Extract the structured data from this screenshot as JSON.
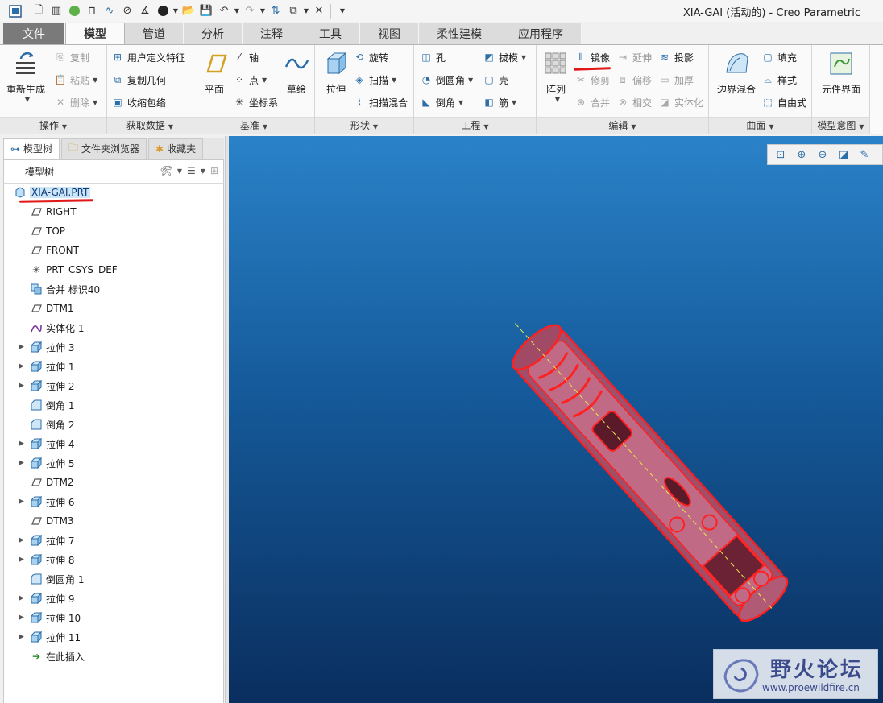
{
  "window": {
    "title": "XIA-GAI (活动的) - Creo Parametric"
  },
  "ribbon_tabs": [
    {
      "label": "文件"
    },
    {
      "label": "模型"
    },
    {
      "label": "管道"
    },
    {
      "label": "分析"
    },
    {
      "label": "注释"
    },
    {
      "label": "工具"
    },
    {
      "label": "视图"
    },
    {
      "label": "柔性建模"
    },
    {
      "label": "应用程序"
    }
  ],
  "groups": {
    "operations": {
      "label": "操作",
      "regenerate": "重新生成",
      "copy": "复制",
      "paste": "粘贴",
      "delete": "删除"
    },
    "get_data": {
      "label": "获取数据",
      "udf": "用户定义特征",
      "copy_geom": "复制几何",
      "shrinkwrap": "收缩包络"
    },
    "datum": {
      "label": "基准",
      "plane": "平面",
      "axis": "轴",
      "point": "点",
      "csys": "坐标系",
      "sketch": "草绘"
    },
    "shapes": {
      "label": "形状",
      "extrude": "拉伸",
      "revolve": "旋转",
      "sweep": "扫描",
      "swept_blend": "扫描混合"
    },
    "engineering": {
      "label": "工程",
      "hole": "孔",
      "round": "倒圆角",
      "chamfer": "倒角",
      "draft": "拔模",
      "shell": "壳",
      "rib": "筋"
    },
    "editing": {
      "label": "编辑",
      "pattern": "阵列",
      "mirror": "镜像",
      "extend": "延伸",
      "project": "投影",
      "trim": "修剪",
      "offset": "偏移",
      "thicken": "加厚",
      "merge": "合并",
      "intersect": "相交",
      "solidify": "实体化"
    },
    "surfaces": {
      "label": "曲面",
      "boundary_blend": "边界混合",
      "fill": "填充",
      "style": "样式",
      "freestyle": "自由式"
    },
    "model_intent": {
      "label": "模型意图",
      "component_interface": "元件界面"
    }
  },
  "navigator": {
    "tabs": [
      {
        "label": "模型树"
      },
      {
        "label": "文件夹浏览器"
      },
      {
        "label": "收藏夹"
      }
    ],
    "header": "模型树",
    "items": [
      {
        "label": "XIA-GAI.PRT",
        "kind": "part-icon",
        "expand": false
      },
      {
        "label": "RIGHT",
        "kind": "datum-plane-icon",
        "expand": false
      },
      {
        "label": "TOP",
        "kind": "datum-plane-icon",
        "expand": false
      },
      {
        "label": "FRONT",
        "kind": "datum-plane-icon",
        "expand": false
      },
      {
        "label": "PRT_CSYS_DEF",
        "kind": "csys-icon",
        "expand": false
      },
      {
        "label": "合并 标识40",
        "kind": "merge-icon",
        "expand": false
      },
      {
        "label": "DTM1",
        "kind": "datum-plane-icon",
        "expand": false
      },
      {
        "label": "实体化 1",
        "kind": "solidify-icon",
        "expand": false
      },
      {
        "label": "拉伸 3",
        "kind": "extrude-icon",
        "expand": true
      },
      {
        "label": "拉伸 1",
        "kind": "extrude-icon",
        "expand": true
      },
      {
        "label": "拉伸 2",
        "kind": "extrude-icon",
        "expand": true
      },
      {
        "label": "倒角 1",
        "kind": "chamfer-icon",
        "expand": false
      },
      {
        "label": "倒角 2",
        "kind": "chamfer-icon",
        "expand": false
      },
      {
        "label": "拉伸 4",
        "kind": "extrude-icon",
        "expand": true
      },
      {
        "label": "拉伸 5",
        "kind": "extrude-icon",
        "expand": true
      },
      {
        "label": "DTM2",
        "kind": "datum-plane-icon",
        "expand": false
      },
      {
        "label": "拉伸 6",
        "kind": "extrude-icon",
        "expand": true
      },
      {
        "label": "DTM3",
        "kind": "datum-plane-icon",
        "expand": false
      },
      {
        "label": "拉伸 7",
        "kind": "extrude-icon",
        "expand": true
      },
      {
        "label": "拉伸 8",
        "kind": "extrude-icon",
        "expand": true
      },
      {
        "label": "倒圆角 1",
        "kind": "round-icon",
        "expand": false
      },
      {
        "label": "拉伸 9",
        "kind": "extrude-icon",
        "expand": true
      },
      {
        "label": "拉伸 10",
        "kind": "extrude-icon",
        "expand": true
      },
      {
        "label": "拉伸 11",
        "kind": "extrude-icon",
        "expand": true
      },
      {
        "label": "在此插入",
        "kind": "insert-here-icon",
        "expand": false
      }
    ]
  },
  "watermark": {
    "title": "野火论坛",
    "url": "www.proewildfire.cn"
  },
  "colors": {
    "highlight": "#e01818",
    "bg_top": "#2a82c8",
    "bg_bottom": "#0a2e5e"
  }
}
